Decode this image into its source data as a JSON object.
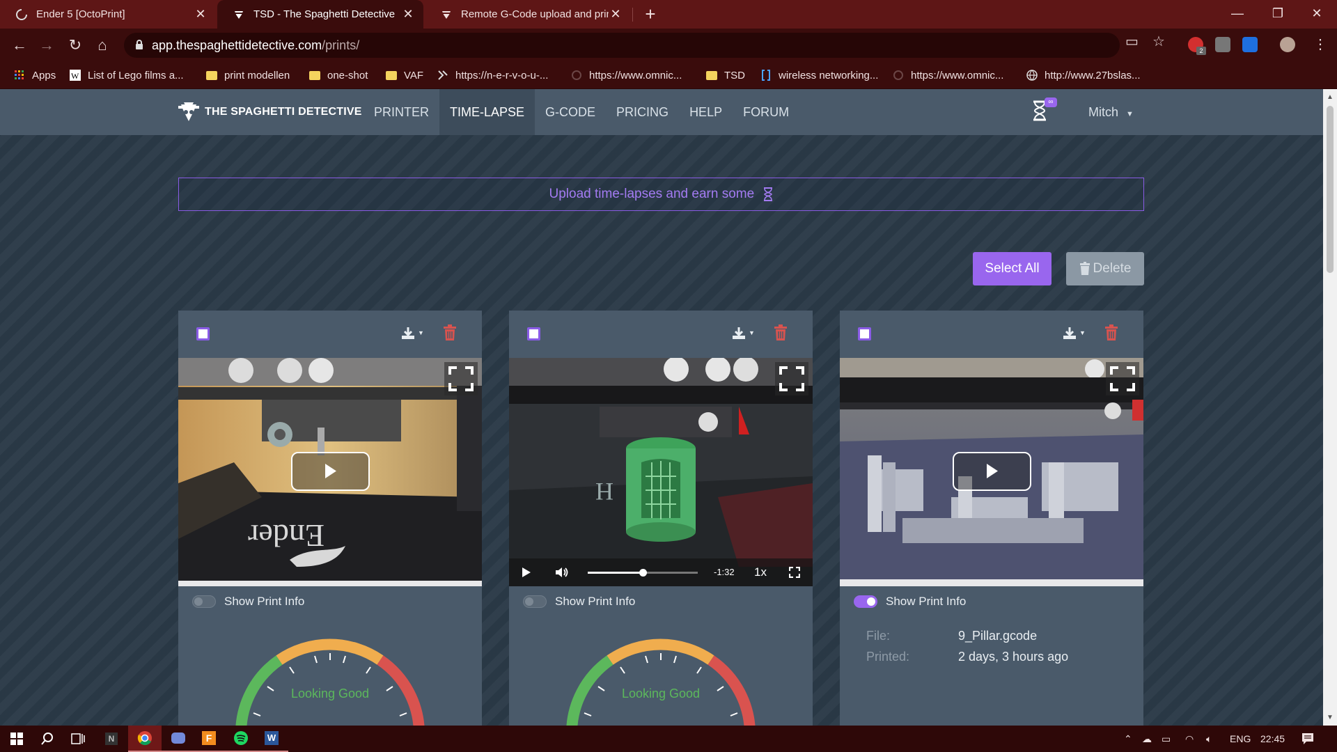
{
  "browser": {
    "tabs": [
      {
        "title": "Ender 5 [OctoPrint]",
        "active": false
      },
      {
        "title": "TSD - The Spaghetti Detective",
        "active": true
      },
      {
        "title": "Remote G-Code upload and prin",
        "active": false
      }
    ],
    "url_host": "app.thespaghettidetective.com",
    "url_path": "/prints/",
    "bookmarks": [
      {
        "label": "Apps",
        "icon": "apps-grid-icon"
      },
      {
        "label": "List of Lego films a...",
        "icon": "wikipedia-icon"
      },
      {
        "label": "print modellen",
        "icon": "folder-icon"
      },
      {
        "label": "one-shot",
        "icon": "folder-icon"
      },
      {
        "label": "VAF",
        "icon": "folder-icon"
      },
      {
        "label": "https://n-e-r-v-o-u-...",
        "icon": "site-icon"
      },
      {
        "label": "https://www.omnic...",
        "icon": "site-icon"
      },
      {
        "label": "TSD",
        "icon": "folder-icon"
      },
      {
        "label": "wireless networking...",
        "icon": "bracket-icon"
      },
      {
        "label": "https://www.omnic...",
        "icon": "site-icon"
      },
      {
        "label": "http://www.27bslas...",
        "icon": "globe-icon"
      }
    ],
    "ext_badge": "2"
  },
  "app": {
    "brand": "THE SPAGHETTI DETECTIVE",
    "nav": [
      {
        "label": "PRINTER",
        "active": false
      },
      {
        "label": "TIME-LAPSE",
        "active": true
      },
      {
        "label": "G-CODE",
        "active": false
      },
      {
        "label": "PRICING",
        "active": false
      },
      {
        "label": "HELP",
        "active": false
      },
      {
        "label": "FORUM",
        "active": false
      }
    ],
    "dh_badge": "∞",
    "user": "Mitch"
  },
  "promo": {
    "text": "Upload time-lapses and earn some"
  },
  "actions": {
    "select_all": "Select All",
    "delete": "Delete"
  },
  "cards": [
    {
      "toggle_label": "Show Print Info",
      "toggle_on": false,
      "gauge_label": "Looking Good",
      "scene": "ender-bed"
    },
    {
      "toggle_label": "Show Print Info",
      "toggle_on": false,
      "gauge_label": "Looking Good",
      "scene": "green-print",
      "video_time": "-1:32",
      "speed": "1x",
      "progress": 0.5
    },
    {
      "toggle_label": "Show Print Info",
      "toggle_on": true,
      "scene": "pillars",
      "file_label": "File:",
      "file_value": "9_Pillar.gcode",
      "printed_label": "Printed:",
      "printed_value": "2 days, 3 hours ago"
    }
  ],
  "taskbar": {
    "lang": "ENG",
    "time": "22:45"
  },
  "colors": {
    "accent": "#9966ee",
    "chrome_dark": "#3a0c0c",
    "nav_bg": "#4a5a6a",
    "page_bg": "#2b3a48",
    "danger": "#d9534f",
    "success": "#5cb85c"
  }
}
